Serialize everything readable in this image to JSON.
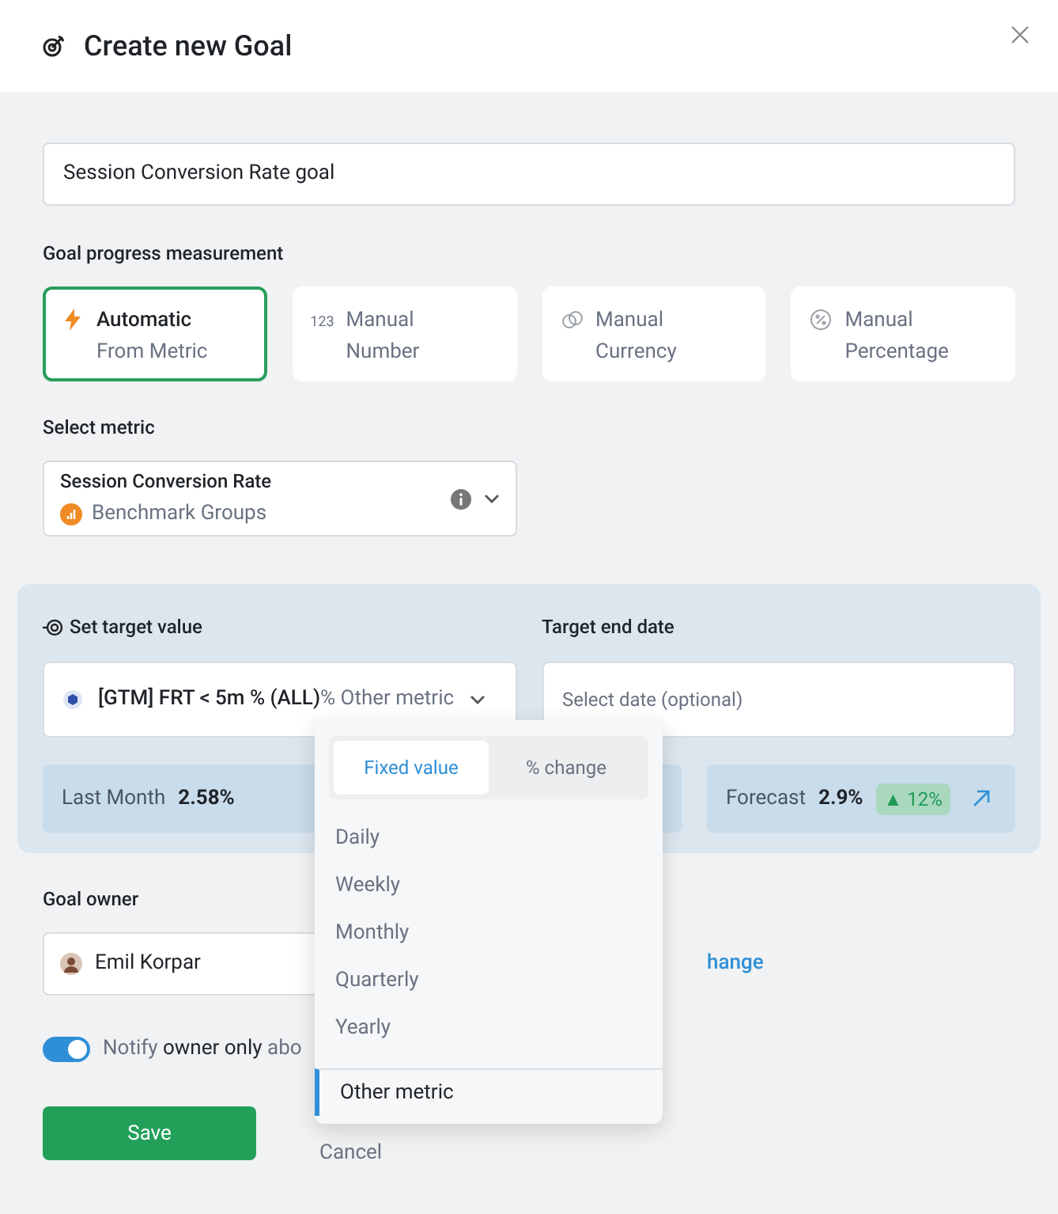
{
  "dialog": {
    "title": "Create new Goal"
  },
  "goal_name": {
    "value": "Session Conversion Rate goal"
  },
  "measurement": {
    "label": "Goal progress measurement",
    "options": [
      {
        "kind": "bolt",
        "title": "Automatic",
        "subtitle": "From Metric",
        "selected": true
      },
      {
        "kind": "number",
        "icon_text": "123",
        "title": "Manual",
        "subtitle": "Number",
        "selected": false
      },
      {
        "kind": "currency",
        "title": "Manual",
        "subtitle": "Currency",
        "selected": false
      },
      {
        "kind": "percent",
        "title": "Manual",
        "subtitle": "Percentage",
        "selected": false
      }
    ]
  },
  "metric": {
    "label": "Select metric",
    "name": "Session Conversion Rate",
    "source": "Benchmark Groups"
  },
  "target": {
    "label": "Set target value",
    "metric": "[GTM] FRT < 5m % (ALL)",
    "mode": "% Other metric",
    "end_date_label": "Target end date",
    "end_date_placeholder": "Select date (optional)",
    "last_month_label": "Last Month",
    "last_month_value": "2.58%",
    "forecast_label": "Forecast",
    "forecast_value": "2.9%",
    "forecast_change": "▲ 12%"
  },
  "owner": {
    "label": "Goal owner",
    "name": "Emil Korpar",
    "change_link": "hange"
  },
  "notify": {
    "on": true,
    "parts": [
      {
        "text": "Notify ",
        "strong": false
      },
      {
        "text": "owner only",
        "strong": true
      },
      {
        "text": " abo",
        "strong": false
      }
    ]
  },
  "buttons": {
    "save": "Save",
    "cancel": "Cancel"
  },
  "dropdown": {
    "tabs": [
      {
        "label": "Fixed value",
        "selected": true
      },
      {
        "label": "% change",
        "selected": false
      }
    ],
    "items": [
      {
        "label": "Daily",
        "selected": false,
        "separated": false
      },
      {
        "label": "Weekly",
        "selected": false,
        "separated": false
      },
      {
        "label": "Monthly",
        "selected": false,
        "separated": false
      },
      {
        "label": "Quarterly",
        "selected": false,
        "separated": false
      },
      {
        "label": "Yearly",
        "selected": false,
        "separated": false
      },
      {
        "label": "Other metric",
        "selected": true,
        "separated": true
      }
    ]
  }
}
